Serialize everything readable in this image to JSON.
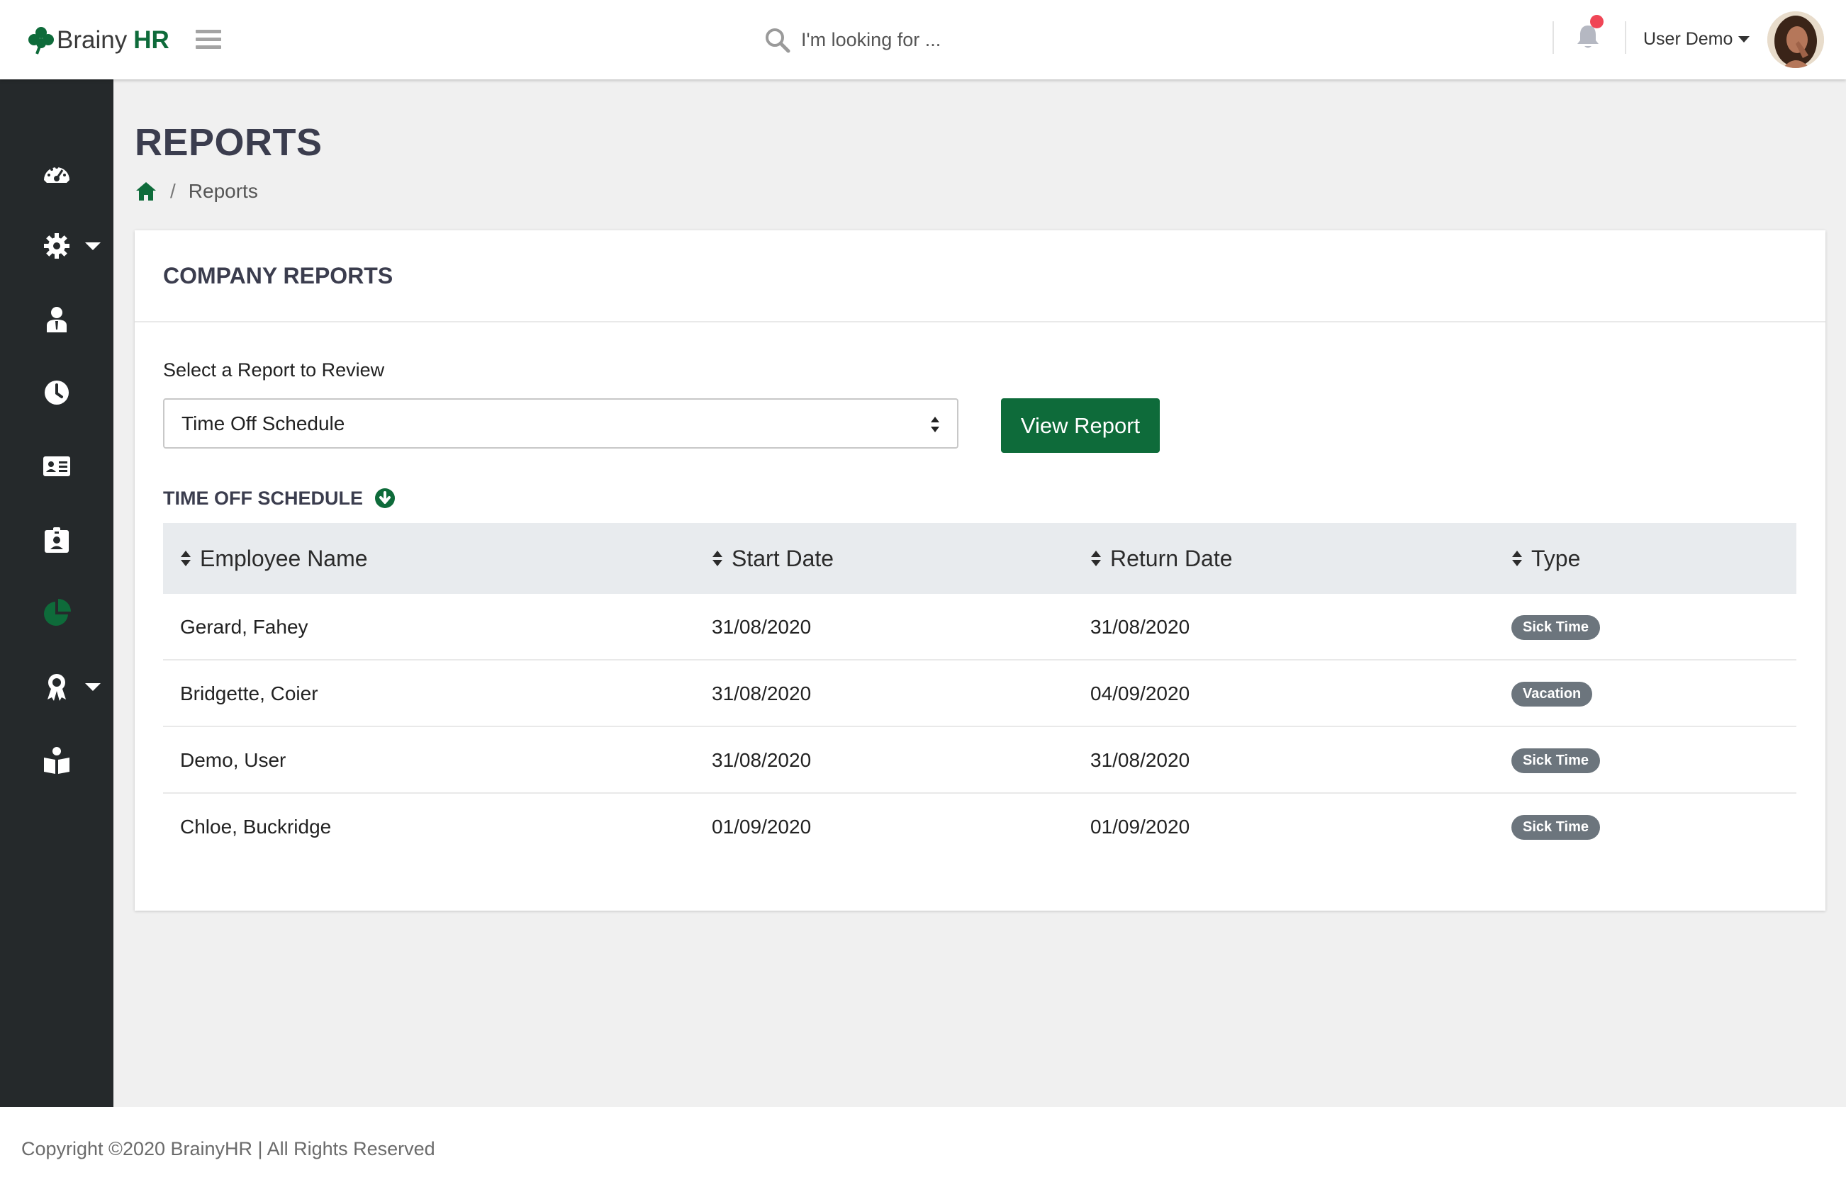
{
  "header": {
    "brand_name": "Brainy",
    "brand_suffix": "HR",
    "search_placeholder": "I'm looking for ...",
    "user_name": "User Demo",
    "accent_color": "#0e6b3a",
    "notification_dot_color": "#f04656"
  },
  "sidebar": {
    "items": [
      {
        "icon": "dashboard-icon",
        "active": false
      },
      {
        "icon": "gear-icon",
        "has_submenu": true,
        "active": false
      },
      {
        "icon": "employee-icon",
        "active": false
      },
      {
        "icon": "clock-icon",
        "active": false
      },
      {
        "icon": "id-card-icon",
        "active": false
      },
      {
        "icon": "id-badge-icon",
        "active": false
      },
      {
        "icon": "pie-chart-icon",
        "active": true
      },
      {
        "icon": "award-icon",
        "has_submenu": true,
        "active": false
      },
      {
        "icon": "reading-icon",
        "active": false
      }
    ]
  },
  "page": {
    "title": "REPORTS",
    "breadcrumb_current": "Reports",
    "breadcrumb_separator": "/"
  },
  "card": {
    "title": "COMPANY REPORTS",
    "select_label": "Select a Report to Review",
    "select_value": "Time Off Schedule",
    "button_label": "View Report",
    "section_title": "TIME OFF SCHEDULE"
  },
  "table": {
    "columns": [
      "Employee Name",
      "Start Date",
      "Return Date",
      "Type"
    ],
    "rows": [
      {
        "name": "Gerard, Fahey",
        "start": "31/08/2020",
        "return": "31/08/2020",
        "type": "Sick Time"
      },
      {
        "name": "Bridgette, Coier",
        "start": "31/08/2020",
        "return": "04/09/2020",
        "type": "Vacation"
      },
      {
        "name": "Demo, User",
        "start": "31/08/2020",
        "return": "31/08/2020",
        "type": "Sick Time"
      },
      {
        "name": "Chloe, Buckridge",
        "start": "01/09/2020",
        "return": "01/09/2020",
        "type": "Sick Time"
      }
    ]
  },
  "footer": {
    "copyright": "Copyright ©2020 BrainyHR | All Rights Reserved"
  }
}
